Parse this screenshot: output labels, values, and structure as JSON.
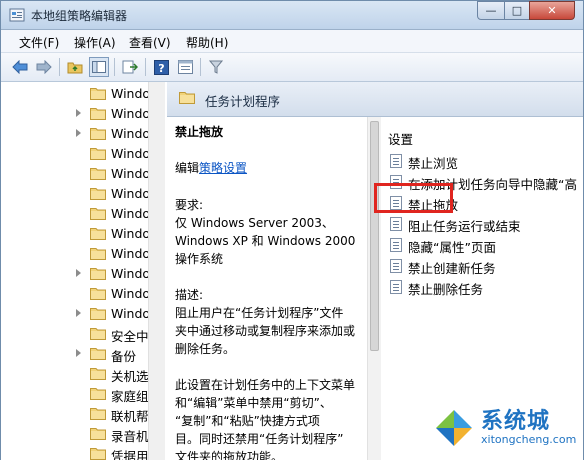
{
  "window": {
    "title": "本地组策略编辑器",
    "controls": {
      "minimize": "—",
      "maximize": "□",
      "close": "✕"
    }
  },
  "menu": [
    {
      "label": "文件(F)"
    },
    {
      "label": "操作(A)"
    },
    {
      "label": "查看(V)"
    },
    {
      "label": "帮助(H)"
    }
  ],
  "toolbar": {
    "icons": [
      "back-arrow-icon",
      "forward-arrow-icon",
      "up-folder-icon",
      "show-hide-tree-icon",
      "export-list-icon",
      "help-icon",
      "properties-icon",
      "filter-icon"
    ]
  },
  "tree": {
    "items": [
      {
        "label": "Windo",
        "expandable": false
      },
      {
        "label": "Windo",
        "expandable": true
      },
      {
        "label": "Windo",
        "expandable": true
      },
      {
        "label": "Windo",
        "expandable": false
      },
      {
        "label": "Windo",
        "expandable": false
      },
      {
        "label": "Windo",
        "expandable": false
      },
      {
        "label": "Windo",
        "expandable": false
      },
      {
        "label": "Windo",
        "expandable": false
      },
      {
        "label": "Windo",
        "expandable": false
      },
      {
        "label": "Windo",
        "expandable": true
      },
      {
        "label": "Windo",
        "expandable": false
      },
      {
        "label": "Windo",
        "expandable": true
      },
      {
        "label": "安全中",
        "expandable": false
      },
      {
        "label": "备份",
        "expandable": true
      },
      {
        "label": "关机选",
        "expandable": false
      },
      {
        "label": "家庭组",
        "expandable": false
      },
      {
        "label": "联机帮",
        "expandable": false
      },
      {
        "label": "录音机",
        "expandable": false
      },
      {
        "label": "凭据用",
        "expandable": false
      }
    ]
  },
  "pane": {
    "header_title": "任务计划程序",
    "description": {
      "title": "禁止拖放",
      "edit_prefix": "编辑",
      "edit_link": "策略设置",
      "requirements_label": "要求:",
      "requirements_lines": [
        "仅 Windows Server 2003、",
        "Windows XP 和 Windows 2000",
        "操作系统"
      ],
      "desc_label": "描述:",
      "desc_lines": [
        "阻止用户在“任务计划程序”文件",
        "夹中通过移动或复制程序来添加或",
        "删除任务。"
      ],
      "extra_lines": [
        "此设置在计划任务中的上下文菜单",
        "和“编辑”菜单中禁用“剪切”、",
        "“复制”和“粘贴”快捷方式项",
        "目。同时还禁用“任务计划程序”",
        "文件夹的拖放功能。"
      ]
    },
    "settings": {
      "header": "设置",
      "items": [
        {
          "label": "禁止浏览"
        },
        {
          "label": "在添加计划任务向导中隐藏“高"
        },
        {
          "label": "禁止拖放",
          "highlighted": true
        },
        {
          "label": "阻止任务运行或结束"
        },
        {
          "label": "隐藏“属性”页面"
        },
        {
          "label": "禁止创建新任务"
        },
        {
          "label": "禁止删除任务"
        }
      ]
    }
  },
  "watermark": {
    "main": "系统城",
    "sub": "xitongcheng.com"
  },
  "colors": {
    "link": "#0b55c4",
    "highlight": "#e0251f",
    "watermark": "#1f73c2"
  }
}
